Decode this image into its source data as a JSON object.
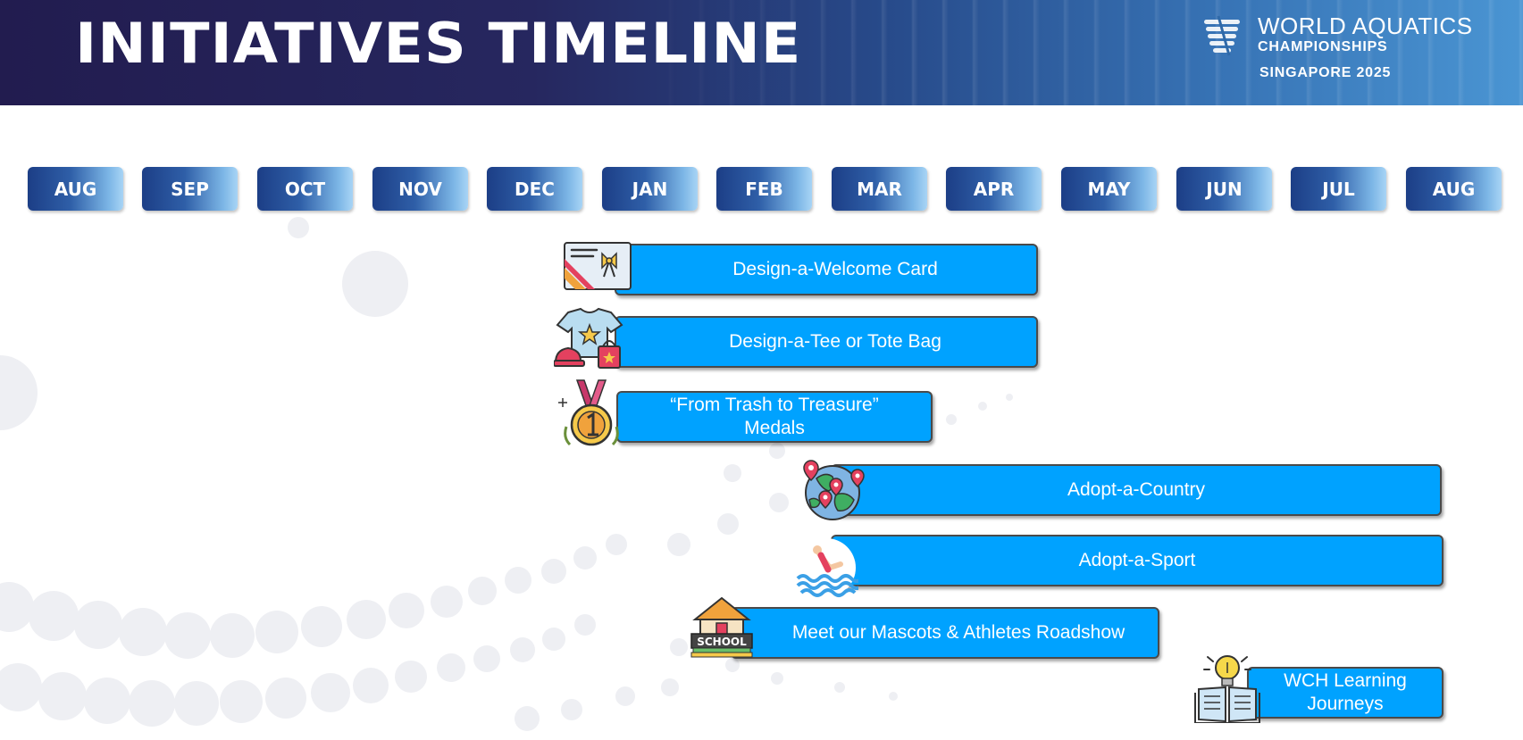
{
  "header": {
    "title": "INITIATIVES TIMELINE",
    "logo": {
      "line1": "WORLD AQUATICS",
      "line2": "CHAMPIONSHIPS",
      "line3": "SINGAPORE 2025"
    }
  },
  "months": [
    "AUG",
    "SEP",
    "OCT",
    "NOV",
    "DEC",
    "JAN",
    "FEB",
    "MAR",
    "APR",
    "MAY",
    "JUN",
    "JUL",
    "AUG"
  ],
  "initiatives": [
    {
      "label": "Design-a-Welcome Card",
      "icon": "greeting-card-icon",
      "start": "DEC",
      "end": "APR"
    },
    {
      "label": "Design-a-Tee or Tote Bag",
      "icon": "tee-and-tote-icon",
      "start": "DEC",
      "end": "APR"
    },
    {
      "label": "“From Trash to Treasure” Medals",
      "icon": "medal-icon",
      "start": "DEC",
      "end": "MAR"
    },
    {
      "label": "Adopt-a-Country",
      "icon": "globe-map-pins-icon",
      "start": "FEB",
      "end": "AUG"
    },
    {
      "label": "Adopt-a-Sport",
      "icon": "swimmer-icon",
      "start": "FEB",
      "end": "AUG"
    },
    {
      "label": "Meet our Mascots & Athletes Roadshow",
      "icon": "school-building-icon",
      "start": "JAN",
      "end": "MAY"
    },
    {
      "label": "WCH Learning Journeys",
      "icon": "book-lightbulb-icon",
      "start": "JUN",
      "end": "AUG"
    }
  ],
  "colors": {
    "header_dark": "#221c4f",
    "header_light": "#4a95d3",
    "bar_fill": "#00a2ff",
    "month_dark": "#1c3e86",
    "month_light": "#a8d4f5"
  }
}
